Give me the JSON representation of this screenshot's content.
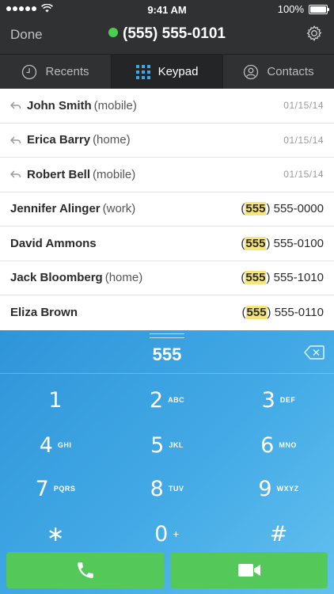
{
  "status": {
    "time": "9:41 AM",
    "battery": "100%"
  },
  "header": {
    "done_label": "Done",
    "caller_number": "(555) 555-0101"
  },
  "tabs": [
    {
      "label": "Recents",
      "icon": "clock-icon",
      "active": false
    },
    {
      "label": "Keypad",
      "icon": "keypad-grid-icon",
      "active": true
    },
    {
      "label": "Contacts",
      "icon": "person-icon",
      "active": false
    }
  ],
  "recents": [
    {
      "name": "John Smith",
      "type": "(mobile)",
      "date": "01/15/14"
    },
    {
      "name": "Erica Barry",
      "type": "(home)",
      "date": "01/15/14"
    },
    {
      "name": "Robert Bell",
      "type": "(mobile)",
      "date": "01/15/14"
    }
  ],
  "contacts": [
    {
      "name": "Jennifer Alinger",
      "type": "(work)",
      "phone_prefix": "(",
      "phone_match": "555",
      "phone_rest": ") 555-0000"
    },
    {
      "name": "David Ammons",
      "type": "",
      "phone_prefix": "(",
      "phone_match": "555",
      "phone_rest": ") 555-0100"
    },
    {
      "name": "Jack Bloomberg",
      "type": "(home)",
      "phone_prefix": "(",
      "phone_match": "555",
      "phone_rest": ") 555-1010"
    },
    {
      "name": "Eliza Brown",
      "type": "",
      "phone_prefix": "(",
      "phone_match": "555",
      "phone_rest": ") 555-0110"
    }
  ],
  "keypad": {
    "entered": "555",
    "keys": [
      {
        "digit": "1",
        "letters": ""
      },
      {
        "digit": "2",
        "letters": "ABC"
      },
      {
        "digit": "3",
        "letters": "DEF"
      },
      {
        "digit": "4",
        "letters": "GHI"
      },
      {
        "digit": "5",
        "letters": "JKL"
      },
      {
        "digit": "6",
        "letters": "MNO"
      },
      {
        "digit": "7",
        "letters": "PQRS"
      },
      {
        "digit": "8",
        "letters": "TUV"
      },
      {
        "digit": "9",
        "letters": "WXYZ"
      },
      {
        "digit": "∗",
        "letters": ""
      },
      {
        "digit": "0",
        "letters": "+"
      },
      {
        "digit": "#",
        "letters": ""
      }
    ]
  },
  "colors": {
    "header_bg": "#2f3133",
    "online": "#4ccd4f",
    "keypad_blue": "#43aae6",
    "call_green": "#55c85a",
    "highlight": "#f7e57a"
  },
  "icons": {
    "voice_call": "phone-handset-icon",
    "video_call": "video-camera-icon",
    "delete": "backspace-icon",
    "settings": "gear-icon"
  }
}
